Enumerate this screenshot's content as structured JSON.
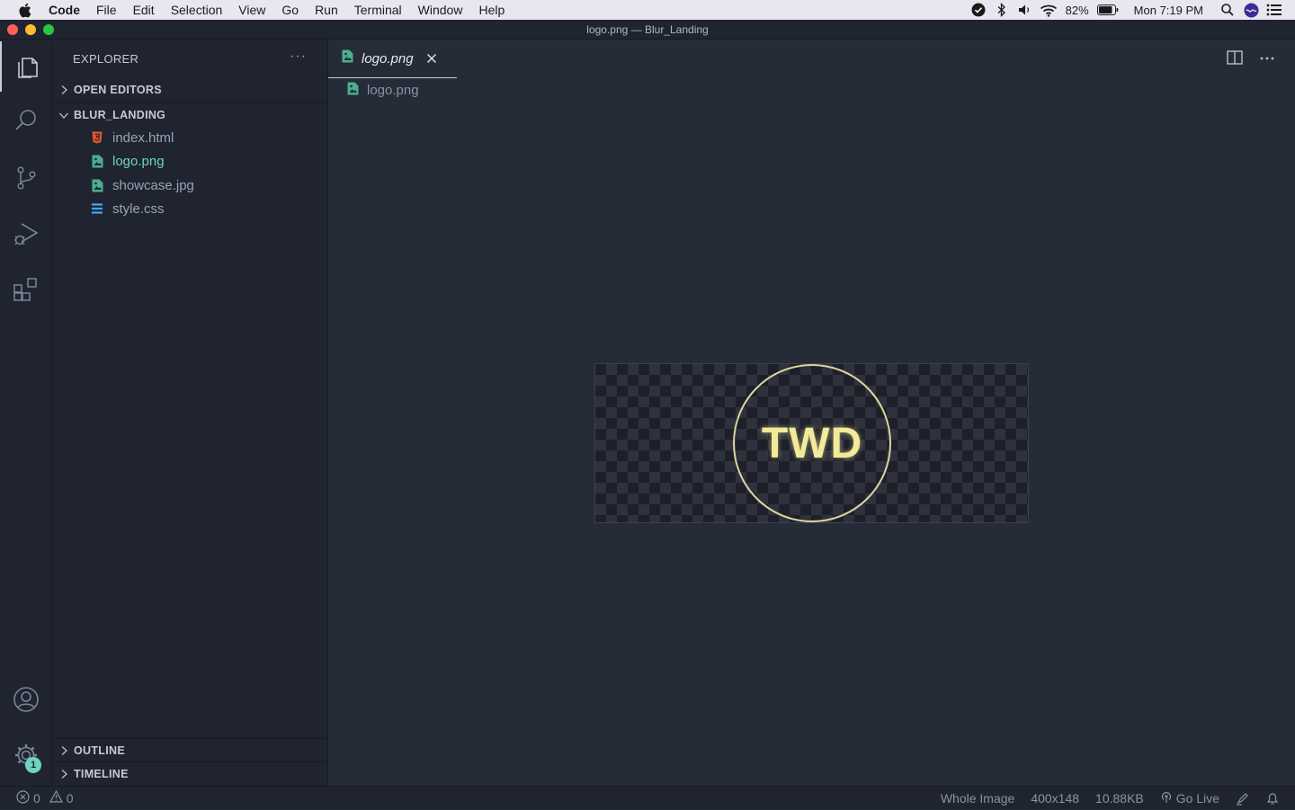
{
  "menubar": {
    "items": [
      "Code",
      "File",
      "Edit",
      "Selection",
      "View",
      "Go",
      "Run",
      "Terminal",
      "Window",
      "Help"
    ],
    "battery": "82%",
    "clock": "Mon 7:19 PM"
  },
  "window": {
    "title": "logo.png — Blur_Landing"
  },
  "sidebar": {
    "title": "EXPLORER",
    "more": "···",
    "sections": {
      "open_editors": "OPEN EDITORS",
      "project": "BLUR_LANDING",
      "outline": "OUTLINE",
      "timeline": "TIMELINE"
    },
    "files": [
      {
        "name": "index.html",
        "type": "html"
      },
      {
        "name": "logo.png",
        "type": "image"
      },
      {
        "name": "showcase.jpg",
        "type": "image"
      },
      {
        "name": "style.css",
        "type": "css"
      }
    ]
  },
  "editor": {
    "tab_label": "logo.png",
    "breadcrumb": "logo.png",
    "image_text": "TWD"
  },
  "activity": {
    "settings_badge": "1"
  },
  "statusbar": {
    "errors": "0",
    "warnings": "0",
    "zoom": "Whole Image",
    "dimensions": "400x148",
    "filesize": "10.88KB",
    "golive": "Go Live"
  },
  "colors": {
    "accent": "#6fd3c0",
    "html_icon": "#e4572e",
    "css_icon": "#42a5f5",
    "logo": "#f3ea9a"
  }
}
